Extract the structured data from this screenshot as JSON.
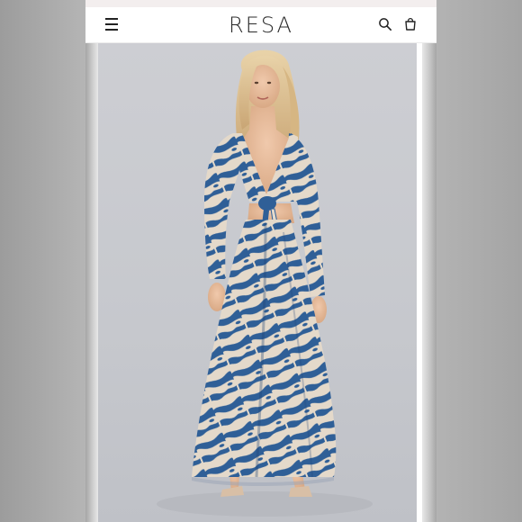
{
  "header": {
    "logo": "RESA",
    "menu_icon": "hamburger-menu-icon",
    "search_icon": "search-icon",
    "cart_icon": "shopping-bag-icon"
  },
  "product_image": {
    "subject": "model-in-blue-print-maxi-dress"
  },
  "colors": {
    "dress_blue": "#2f5f97",
    "dress_cream": "#e6dccd",
    "backdrop": "#c8c9ce",
    "text": "#2b2b2b"
  }
}
